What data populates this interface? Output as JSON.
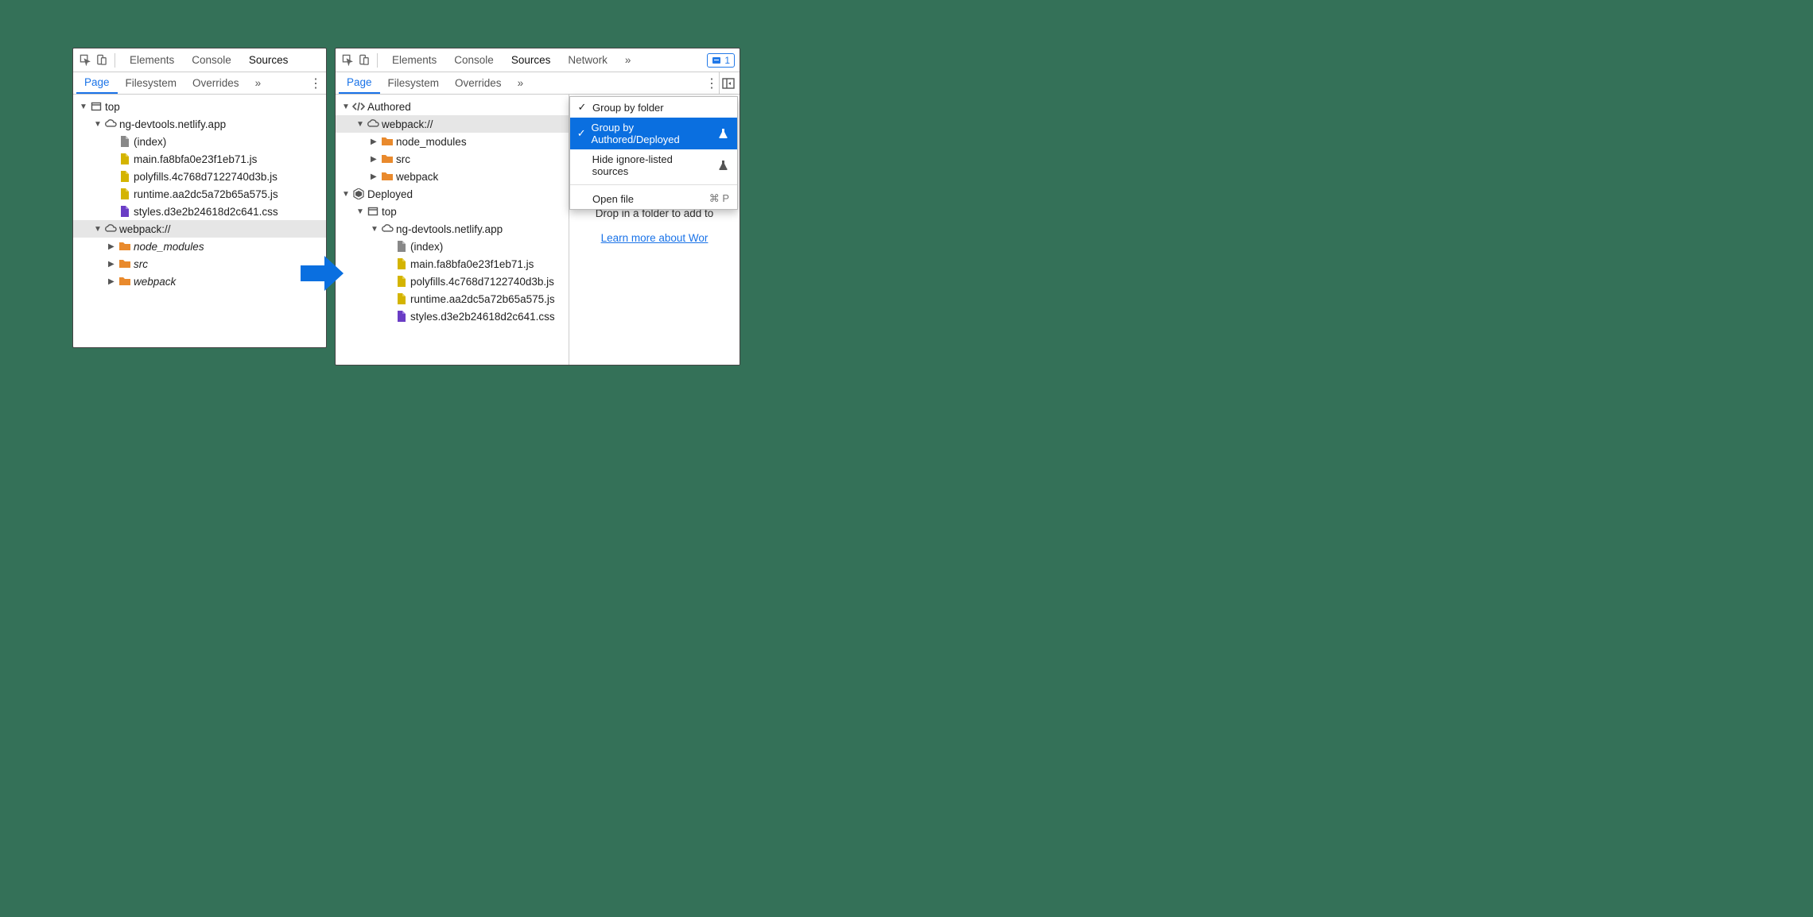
{
  "toolbar": {
    "tabs": [
      "Elements",
      "Console",
      "Sources",
      "Network"
    ],
    "more": "»",
    "issues_count": "1"
  },
  "subtabs": {
    "page": "Page",
    "filesystem": "Filesystem",
    "overrides": "Overrides",
    "more": "»"
  },
  "left_tree": {
    "top": "top",
    "domain": "ng-devtools.netlify.app",
    "index": "(index)",
    "main": "main.fa8bfa0e23f1eb71.js",
    "polyfills": "polyfills.4c768d7122740d3b.js",
    "runtime": "runtime.aa2dc5a72b65a575.js",
    "styles": "styles.d3e2b24618d2c641.css",
    "webpack": "webpack://",
    "node_modules": "node_modules",
    "src": "src",
    "webpack_folder": "webpack"
  },
  "right_tree": {
    "authored": "Authored",
    "webpack": "webpack://",
    "node_modules": "node_modules",
    "src": "src",
    "webpack_folder": "webpack",
    "deployed": "Deployed",
    "top": "top",
    "domain": "ng-devtools.netlify.app",
    "index": "(index)",
    "main": "main.fa8bfa0e23f1eb71.js",
    "polyfills": "polyfills.4c768d7122740d3b.js",
    "runtime": "runtime.aa2dc5a72b65a575.js",
    "styles": "styles.d3e2b24618d2c641.css"
  },
  "menu": {
    "group_folder": "Group by folder",
    "group_authored": "Group by Authored/Deployed",
    "hide_ignore": "Hide ignore-listed sources",
    "open_file": "Open file",
    "open_shortcut": "⌘ P"
  },
  "side": {
    "drop": "Drop in a folder to add to",
    "learn": "Learn more about Wor"
  }
}
